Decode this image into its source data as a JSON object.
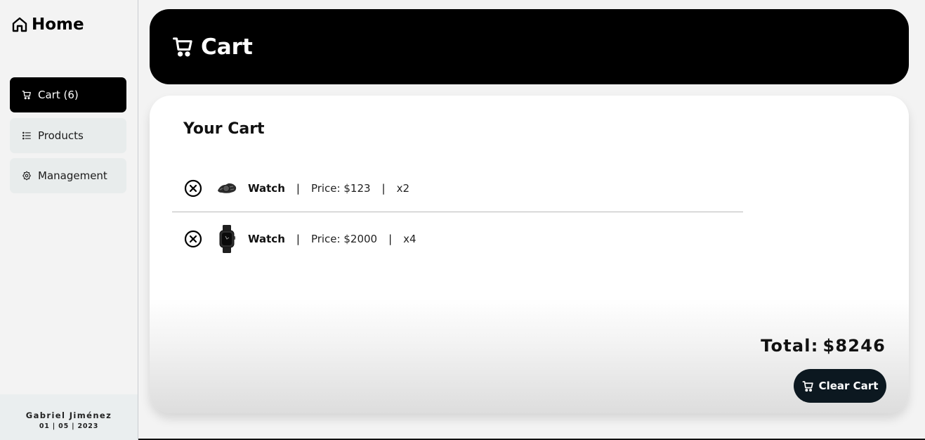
{
  "sidebar": {
    "home_label": "Home",
    "nav": [
      {
        "label": "Cart (6)",
        "icon": "cart-icon",
        "active": true
      },
      {
        "label": "Products",
        "icon": "list-icon",
        "active": false
      },
      {
        "label": "Management",
        "icon": "gear-icon",
        "active": false
      }
    ],
    "footer": {
      "name": "Gabriel Jiménez",
      "date": "01 | 05 | 2023"
    }
  },
  "header": {
    "title": "Cart",
    "icon": "cart-icon"
  },
  "cart": {
    "heading": "Your Cart",
    "items": [
      {
        "name": "Watch",
        "price": "Price: $123",
        "qty": "x2",
        "separator": "|",
        "thumb": "dark-chain-watch"
      },
      {
        "name": "Watch",
        "price": "Price: $2000",
        "qty": "x4",
        "separator": "|",
        "thumb": "smartwatch"
      }
    ],
    "total_label": "Total:",
    "total_value": "$8246",
    "clear_label": "Clear Cart"
  },
  "colors": {
    "accent": "#000000",
    "button": "#0c1820",
    "sidebar_bg": "#f3f3f3",
    "nav_bg": "#e8ecec"
  }
}
